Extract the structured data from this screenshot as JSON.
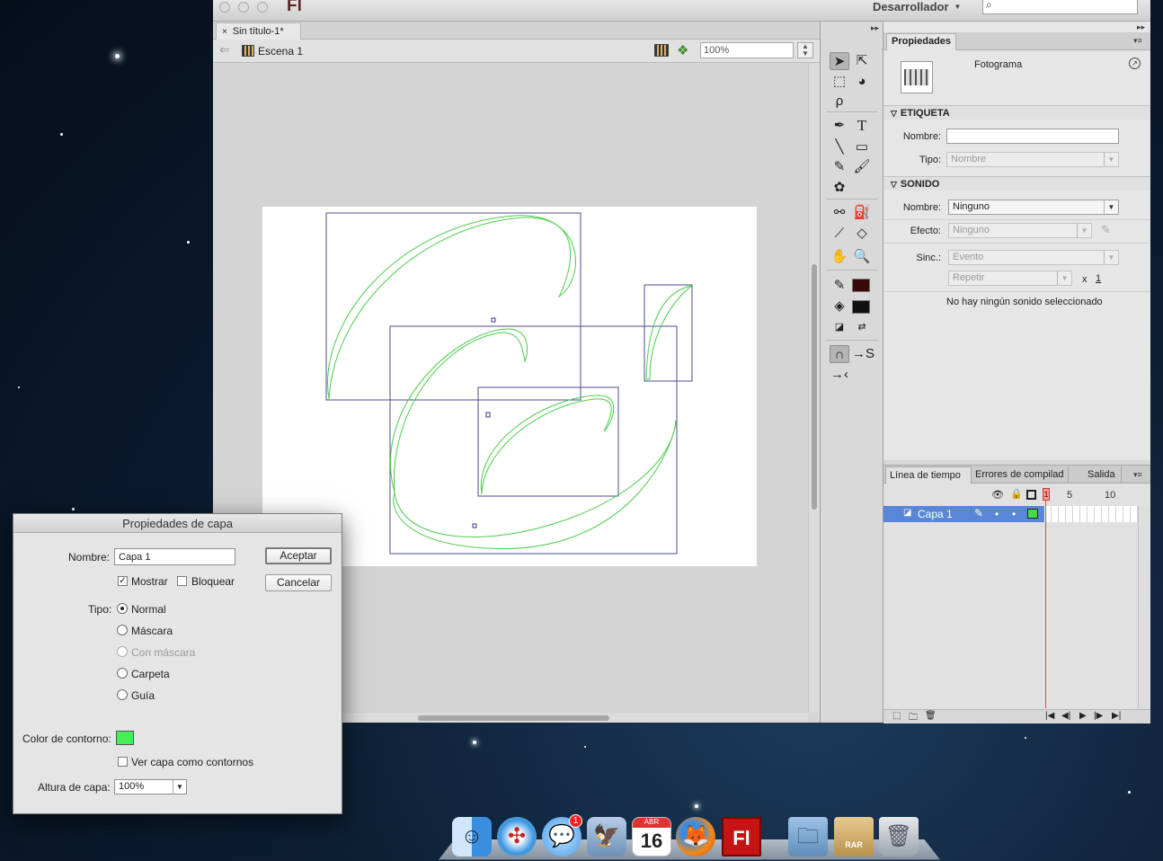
{
  "window": {
    "app_logo": "Fl",
    "workspace": "Desarrollador",
    "search_placeholder": ""
  },
  "document": {
    "tab_title": "Sin título-1*",
    "tab_close": "×",
    "scene": "Escena 1",
    "zoom": "100%"
  },
  "properties": {
    "tab": "Propiedades",
    "header": "Fotograma",
    "label_section": {
      "title": "ETIQUETA",
      "name_label": "Nombre:",
      "name_value": "",
      "type_label": "Tipo:",
      "type_value": "Nombre"
    },
    "sound_section": {
      "title": "SONIDO",
      "name_label": "Nombre:",
      "name_value": "Ninguno",
      "effect_label": "Efecto:",
      "effect_value": "Ninguno",
      "sync_label": "Sinc.:",
      "sync_value": "Evento",
      "repeat_value": "Repetir",
      "repeat_times_prefix": "x",
      "repeat_times": "1",
      "status": "No hay ningún sonido seleccionado"
    }
  },
  "timeline": {
    "tabs": [
      "Línea de tiempo",
      "Errores de compilad",
      "Salida"
    ],
    "frame_numbers": [
      "1",
      "5",
      "10"
    ],
    "layer_name": "Capa 1",
    "layer_outline_color": "#44dd44"
  },
  "dialog": {
    "title": "Propiedades de capa",
    "name_label": "Nombre:",
    "name_value": "Capa 1",
    "ok": "Aceptar",
    "cancel": "Cancelar",
    "show_label": "Mostrar",
    "show_checked": true,
    "lock_label": "Bloquear",
    "lock_checked": false,
    "type_label": "Tipo:",
    "types": [
      "Normal",
      "Máscara",
      "Con máscara",
      "Carpeta",
      "Guía"
    ],
    "selected_type": "Normal",
    "outline_color_label": "Color de contorno:",
    "outline_color": "#44ee55",
    "view_outlines_label": "Ver capa como contornos",
    "view_outlines_checked": false,
    "height_label": "Altura de capa:",
    "height_value": "100%"
  },
  "stage": {
    "stroke_color": "#4ccd4c",
    "bbox_color": "#4b4b8f"
  },
  "dock": {
    "apps": [
      "finder",
      "safari",
      "messages",
      "mail",
      "calendar",
      "firefox",
      "flash",
      "folder",
      "rar-archive",
      "trash"
    ],
    "calendar_day": "16",
    "calendar_month": "ABR",
    "messages_badge": "1",
    "flash_label": "Fl",
    "rar_label": "RAR"
  }
}
